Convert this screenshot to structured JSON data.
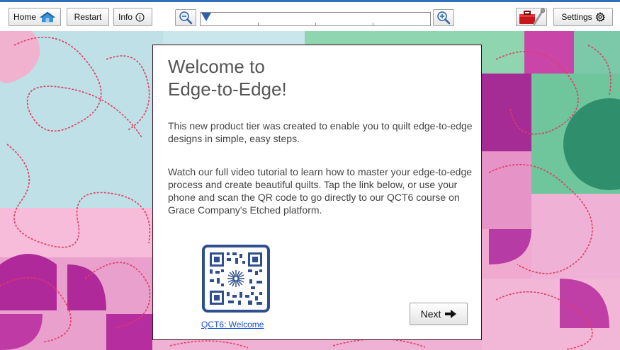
{
  "toolbar": {
    "home_label": "Home",
    "restart_label": "Restart",
    "info_label": "Info",
    "settings_label": "Settings",
    "zoom_level": 0
  },
  "dialog": {
    "title_line1": "Welcome to",
    "title_line2": "Edge-to-Edge!",
    "paragraph1": "This new product tier was created to enable you to quilt edge-to-edge designs in simple, easy steps.",
    "paragraph2": "Watch our full video tutorial to learn how to master your edge-to-edge process and create beautiful quilts. Tap the link below, or use your phone and scan the QR code to go directly to our QCT6 course on Grace Company's Etched platform.",
    "link_label": "QCT6: Welcome",
    "next_label": "Next",
    "next_icon": "arrow-right-icon"
  },
  "colors": {
    "accent": "#2f6fb5",
    "qr_frame": "#2f4f8f",
    "link": "#1a4fd0",
    "dialog_border": "#3a0f1e"
  }
}
